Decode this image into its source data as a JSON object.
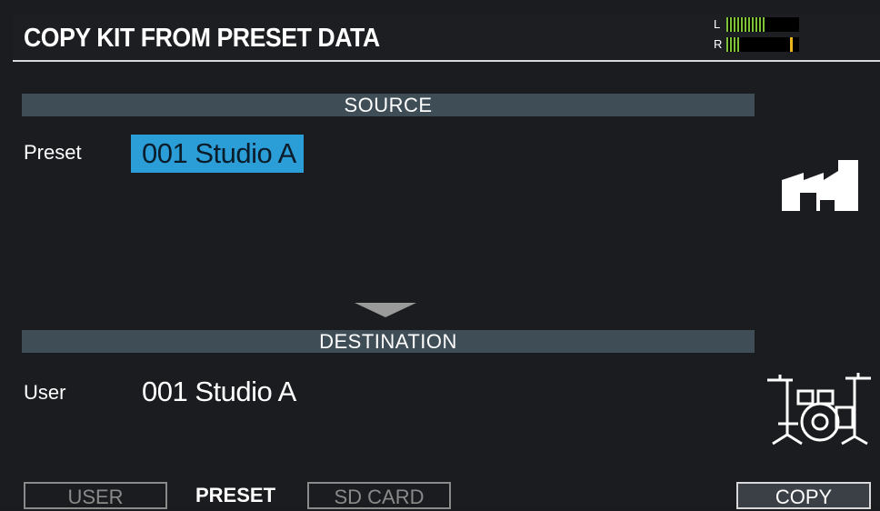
{
  "header": {
    "title": "COPY KIT FROM PRESET DATA"
  },
  "level_meter": {
    "left_label": "L",
    "right_label": "R",
    "left_level": 0.55,
    "right_level": 0.22,
    "right_peak": 0.95,
    "bar_color": "#7ec23a",
    "peak_color": "#e8b520"
  },
  "source": {
    "section_label": "SOURCE",
    "bank_label": "Preset",
    "kit_value": "001 Studio A",
    "highlight_color": "#2b9ed8"
  },
  "destination": {
    "section_label": "DESTINATION",
    "bank_label": "User",
    "kit_value": "001 Studio A"
  },
  "icons": {
    "source": "factory-icon",
    "destination": "drum-kit-icon",
    "flow": "down-arrow-icon"
  },
  "tabs": [
    {
      "label": "USER",
      "state": "inactive"
    },
    {
      "label": "PRESET",
      "state": "selected"
    },
    {
      "label": "SD CARD",
      "state": "inactive"
    }
  ],
  "action": {
    "copy_label": "COPY"
  }
}
